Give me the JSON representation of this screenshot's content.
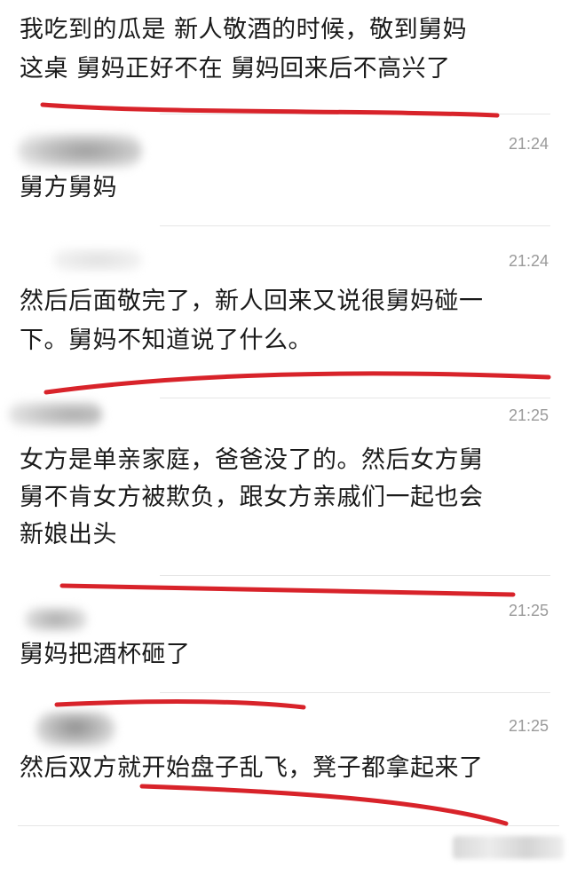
{
  "messages": [
    {
      "text_lines": [
        "我吃到的瓜是 新人敬酒的时候，敬到舅妈",
        "这桌 舅妈正好不在 舅妈回来后不高兴了"
      ]
    },
    {
      "time": "21:24",
      "text_lines": [
        "舅方舅妈"
      ]
    },
    {
      "time": "21:24",
      "text_lines": [
        "然后后面敬完了，新人回来又说很舅妈碰一",
        "下。舅妈不知道说了什么。"
      ]
    },
    {
      "time": "21:25",
      "text_lines": [
        "女方是单亲家庭，爸爸没了的。然后女方舅",
        "舅不肯女方被欺负，跟女方亲戚们一起也会",
        "新娘出头"
      ]
    },
    {
      "time": "21:25",
      "text_lines": [
        "舅妈把酒杯砸了"
      ]
    },
    {
      "time": "21:25",
      "text_lines": [
        "然后双方就开始盘子乱飞，凳子都拿起来了"
      ]
    }
  ],
  "colors": {
    "underline": "#d8232a",
    "timestamp": "#9a9a9a",
    "text": "#1a1a1a"
  }
}
